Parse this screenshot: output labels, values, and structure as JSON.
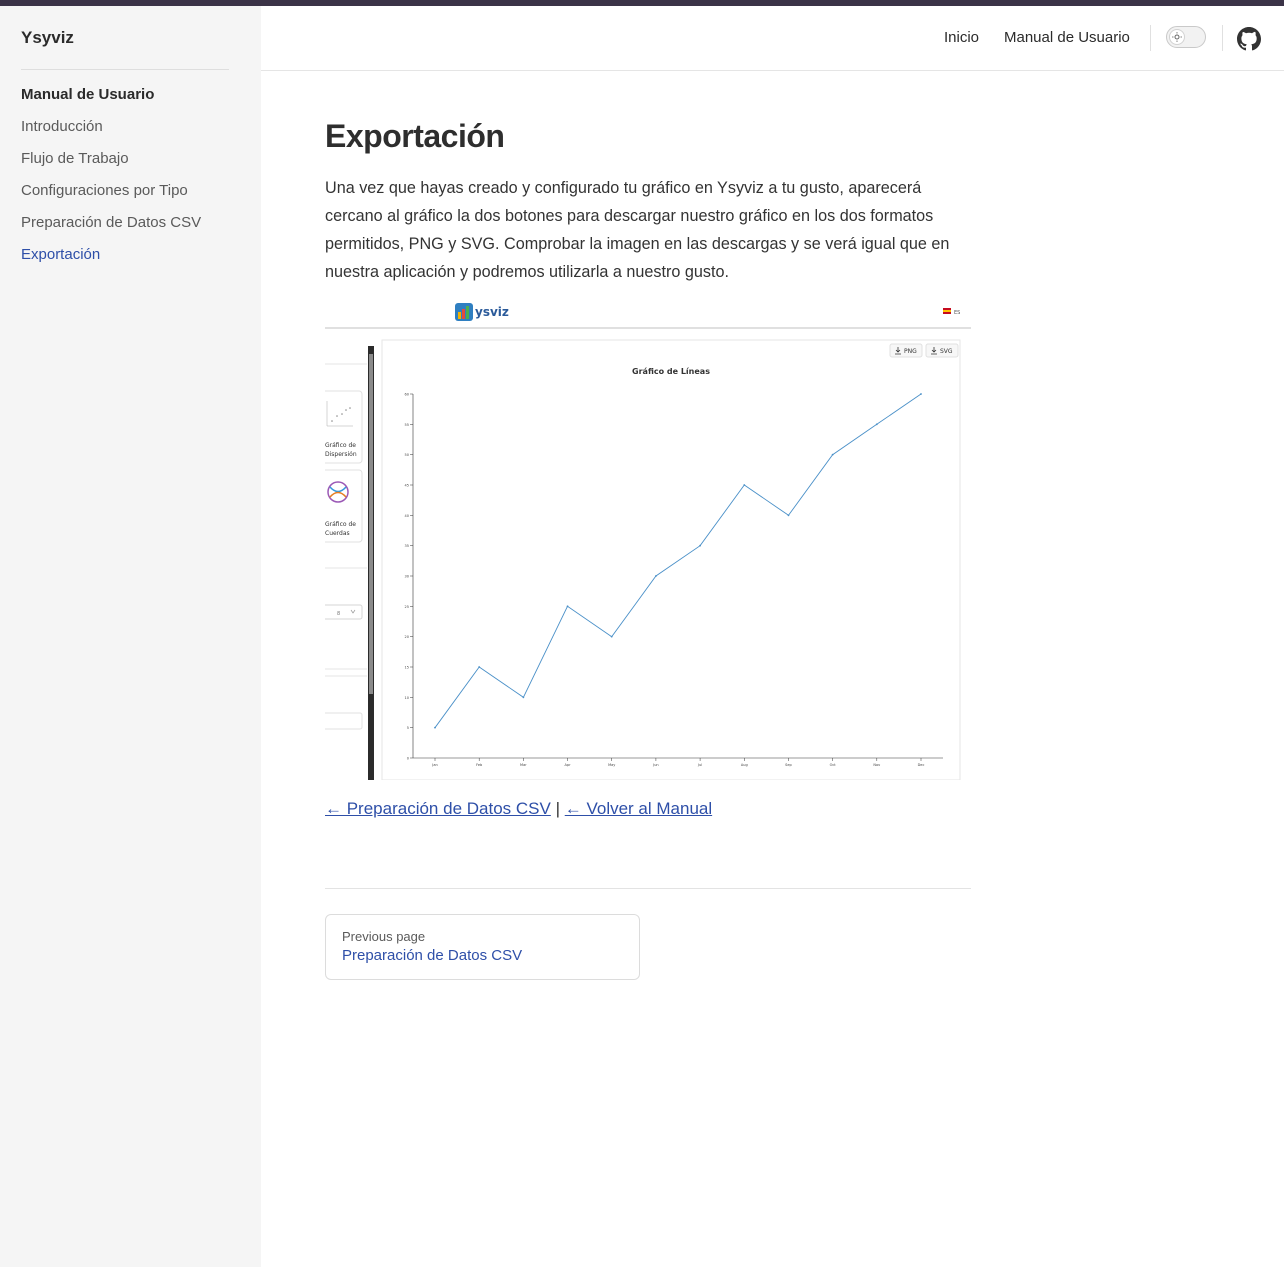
{
  "brand": "Ysyviz",
  "sidebar": {
    "items": [
      {
        "label": "Manual de Usuario"
      },
      {
        "label": "Introducción"
      },
      {
        "label": "Flujo de Trabajo"
      },
      {
        "label": "Configuraciones por Tipo"
      },
      {
        "label": "Preparación de Datos CSV"
      },
      {
        "label": "Exportación"
      }
    ]
  },
  "header": {
    "nav": [
      {
        "label": "Inicio"
      },
      {
        "label": "Manual de Usuario"
      }
    ],
    "theme_toggle_icon": "sun-icon",
    "github_icon": "github-icon"
  },
  "page": {
    "title": "Exportación",
    "paragraph": "Una vez que hayas creado y configurado tu gráfico en Ysyviz a tu gusto, aparecerá cercano al gráfico la dos botones para descargar nuestro gráfico en los dos formatos permitidos, PNG y SVG. Comprobar la imagen en las descargas y se verá igual que en nuestra aplicación y podremos utilizarla a nuestro gusto.",
    "links": {
      "prev": "← Preparación de Datos CSV",
      "separator": "|",
      "back": "← Volver al Manual"
    },
    "prev_page": {
      "label": "Previous page",
      "title": "Preparación de Datos CSV"
    }
  },
  "screenshot": {
    "logo_text": "ysviz",
    "lang": "ES",
    "png_button": "PNG",
    "svg_button": "SVG",
    "card1_label_line1": "Gráfico de",
    "card1_label_line2": "Dispersión",
    "card2_label_line1": "Gráfico de",
    "card2_label_line2": "Cuerdas",
    "select_value": "8"
  },
  "chart_data": {
    "type": "line",
    "title": "Gráfico de Líneas",
    "categories": [
      "Jan",
      "Feb",
      "Mar",
      "Apr",
      "May",
      "Jun",
      "Jul",
      "Aug",
      "Sep",
      "Oct",
      "Nov",
      "Dec"
    ],
    "values": [
      5,
      15,
      10,
      25,
      20,
      30,
      35,
      45,
      40,
      50,
      55,
      60
    ],
    "yticks": [
      0,
      5,
      10,
      15,
      20,
      25,
      30,
      35,
      40,
      45,
      50,
      55,
      60
    ],
    "ylim": [
      0,
      60
    ],
    "color": "#4a90c8"
  }
}
